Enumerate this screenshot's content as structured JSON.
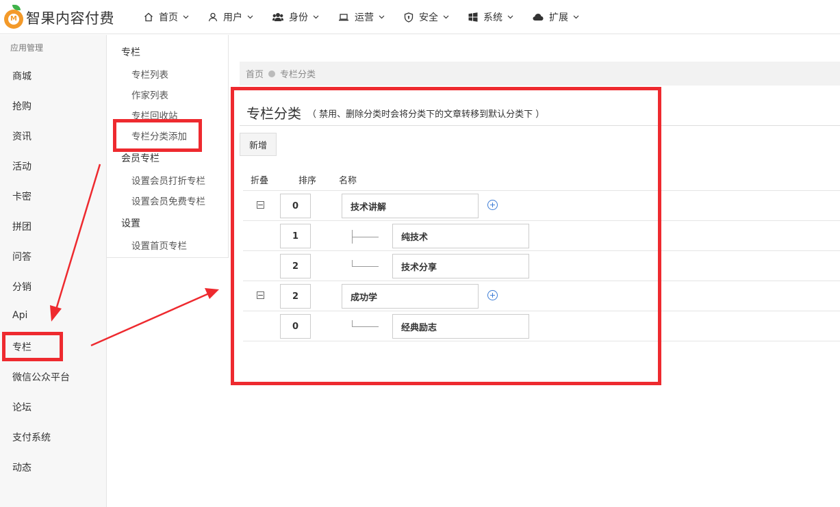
{
  "brand": {
    "name": "智果内容付费",
    "logo_icon": "orange-logo-icon",
    "logo_mark": "M"
  },
  "nav": [
    {
      "label": "首页",
      "icon": "home-icon"
    },
    {
      "label": "用户",
      "icon": "user-icon"
    },
    {
      "label": "身份",
      "icon": "users-icon"
    },
    {
      "label": "运营",
      "icon": "laptop-icon"
    },
    {
      "label": "安全",
      "icon": "shield-icon"
    },
    {
      "label": "系统",
      "icon": "windows-icon"
    },
    {
      "label": "扩展",
      "icon": "cloud-icon"
    }
  ],
  "sidebar": {
    "heading": "应用管理",
    "items": [
      "商城",
      "抢购",
      "资讯",
      "活动",
      "卡密",
      "拼团",
      "问答",
      "分销",
      "Api",
      "专栏",
      "微信公众平台",
      "论坛",
      "支付系统",
      "动态"
    ]
  },
  "submenu": {
    "groups": [
      {
        "title": "专栏",
        "items": [
          "专栏列表",
          "作家列表",
          "专栏回收站",
          "专栏分类添加"
        ]
      },
      {
        "title": "会员专栏",
        "items": [
          "设置会员打折专栏",
          "设置会员免费专栏"
        ]
      },
      {
        "title": "设置",
        "items": [
          "设置首页专栏"
        ]
      }
    ]
  },
  "breadcrumb": {
    "home": "首页",
    "current": "专栏分类"
  },
  "page": {
    "title": "专栏分类",
    "note": "（ 禁用、删除分类时会将分类下的文章转移到默认分类下 ）",
    "new_button": "新增"
  },
  "table": {
    "headers": {
      "fold": "折叠",
      "sort": "排序",
      "name": "名称"
    },
    "rows": [
      {
        "sort": "0",
        "name": "技术讲解",
        "level": 0
      },
      {
        "sort": "1",
        "name": "纯技术",
        "level": 1
      },
      {
        "sort": "2",
        "name": "技术分享",
        "level": 1
      },
      {
        "sort": "2",
        "name": "成功学",
        "level": 0
      },
      {
        "sort": "0",
        "name": "经典励志",
        "level": 1
      }
    ]
  },
  "colors": {
    "annotation": "#ee2a2f",
    "accent": "#3c7cd6",
    "brand_orange": "#f39a2a"
  }
}
